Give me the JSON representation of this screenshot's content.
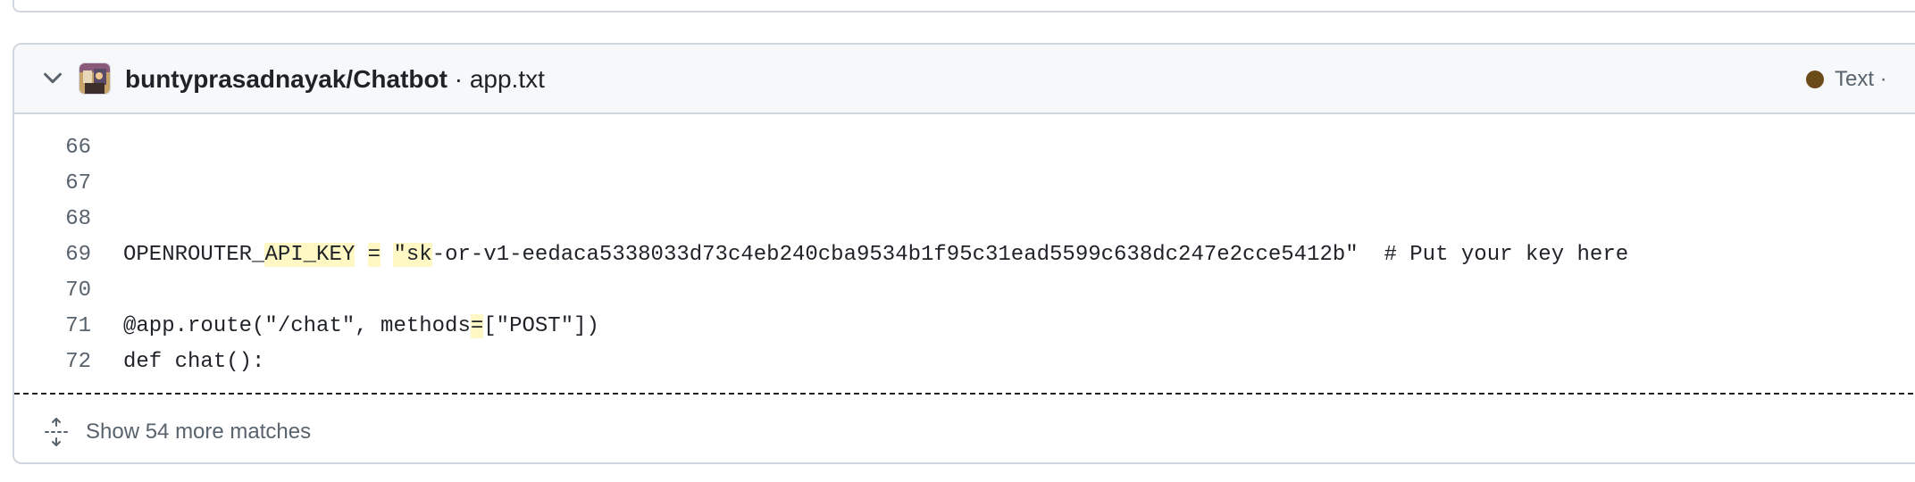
{
  "result": {
    "repo": "buntyprasadnayak/Chatbot",
    "separator": " · ",
    "file": "app.txt",
    "language": "Text",
    "language_trailing": " ·",
    "language_color": "#6b4b1a",
    "icons": {
      "toggle": "chevron-down-icon",
      "avatar": "owner-avatar",
      "expand": "unfold-icon"
    },
    "lines": [
      {
        "number": "66",
        "parts": []
      },
      {
        "number": "67",
        "parts": []
      },
      {
        "number": "68",
        "parts": []
      },
      {
        "number": "69",
        "parts": [
          {
            "text": "OPENROUTER_",
            "hl": false
          },
          {
            "text": "API_KEY",
            "hl": true
          },
          {
            "text": " ",
            "hl": false
          },
          {
            "text": "=",
            "hl": true
          },
          {
            "text": " ",
            "hl": false
          },
          {
            "text": "\"sk",
            "hl": true
          },
          {
            "text": "-or-v1-eedaca5338033d73c4eb240cba9534b1f95c31ead5599c638dc247e2cce5412b\"  # Put your key here",
            "hl": false
          }
        ]
      },
      {
        "number": "70",
        "parts": []
      },
      {
        "number": "71",
        "parts": [
          {
            "text": "@app.route(\"/chat\", methods",
            "hl": false
          },
          {
            "text": "=",
            "hl": true
          },
          {
            "text": "[\"POST\"])",
            "hl": false
          }
        ]
      },
      {
        "number": "72",
        "parts": [
          {
            "text": "def chat():",
            "hl": false
          }
        ]
      }
    ],
    "more_matches_label": "Show 54 more matches"
  }
}
